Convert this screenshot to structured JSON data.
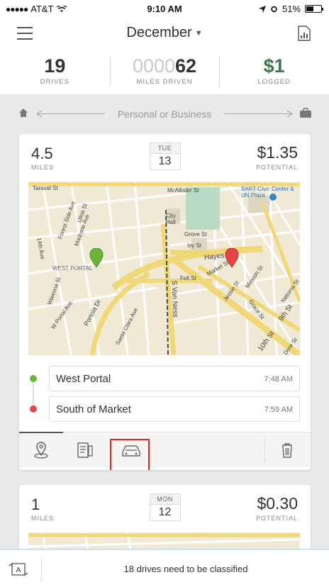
{
  "status_bar": {
    "carrier": "AT&T",
    "time": "9:10 AM",
    "battery": "51%",
    "battery_level": 0.51
  },
  "header": {
    "month": "December"
  },
  "stats": {
    "drives": {
      "value": "19",
      "label": "DRIVES"
    },
    "miles": {
      "faded": "0000",
      "value": "62",
      "label": "MILES DRIVEN"
    },
    "logged": {
      "value": "$1",
      "label": "LOGGED"
    }
  },
  "swipe_hint": "Personal or Business",
  "drives": [
    {
      "miles": "4.5",
      "miles_label": "MILES",
      "dow": "TUE",
      "day": "13",
      "potential": "$1.35",
      "potential_label": "POTENTIAL",
      "start": {
        "name": "West Portal",
        "time": "7:48 AM"
      },
      "end": {
        "name": "South of Market",
        "time": "7:59 AM"
      },
      "map_labels": {
        "taraval": "Taraval St",
        "west_portal": "WEST PORTAL",
        "hayes": "Hayes St",
        "fell": "Fell St",
        "city_hall": "City Hall",
        "grove": "Grove St",
        "ivy": "Ivy St",
        "bart": "BART-Civic Center & UN Plaza",
        "portola": "Portola Dr",
        "mission": "Mission St",
        "tenth": "10th St",
        "ninth": "9th St",
        "van_ness": "S Van Ness",
        "mcallister": "McAllister St",
        "ulloa": "Ulloa St",
        "forest_side": "Forest Side Ave",
        "madrone": "Madrone Ave",
        "wawona": "Wawona St",
        "w_portal_ave": "W Portal Ave",
        "santa_clara": "Santa Clara Ave",
        "fourteenth": "14th Ave",
        "jessie": "Jessie St",
        "grace": "Grace St",
        "market": "Market St",
        "dore": "Dore St",
        "natoma": "Natoma St"
      }
    },
    {
      "miles": "1",
      "miles_label": "MILES",
      "dow": "MON",
      "day": "12",
      "potential": "$0.30",
      "potential_label": "POTENTIAL"
    }
  ],
  "bottom": {
    "message": "18 drives need to be classified"
  },
  "colors": {
    "logged_green": "#3a7a4a",
    "start_pin": "#6bb33a",
    "end_pin": "#e84545",
    "highlight": "#e1251b"
  },
  "icons": [
    "menu-icon",
    "report-icon",
    "home-icon",
    "briefcase-icon",
    "map-pin-icon",
    "expense-icon",
    "car-icon",
    "trash-icon",
    "auto-classify-icon"
  ]
}
